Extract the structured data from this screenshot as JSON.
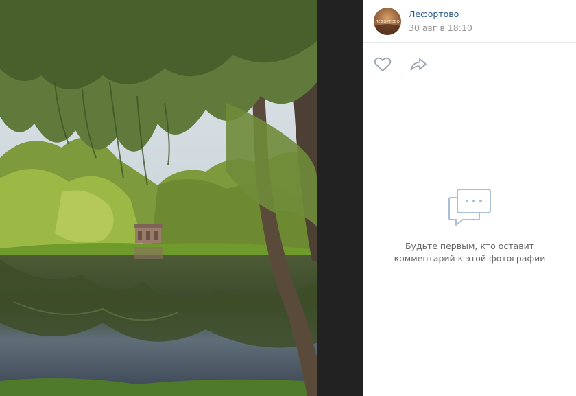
{
  "post": {
    "author": "Лефортово",
    "date": "30 авг в 18:10",
    "avatar_text": "ЛЕФОРТОВО"
  },
  "actions": {
    "like_icon": "heart-icon",
    "share_icon": "share-arrow-icon"
  },
  "comments": {
    "empty_icon": "chat-bubbles-icon",
    "empty_text": "Будьте первым, кто оставит комментарий к этой фотографии"
  },
  "colors": {
    "link": "#2a5885",
    "muted": "#939393",
    "icon": "#99a2ad",
    "viewer_bg": "#222222",
    "divider": "#e7e8ec"
  }
}
